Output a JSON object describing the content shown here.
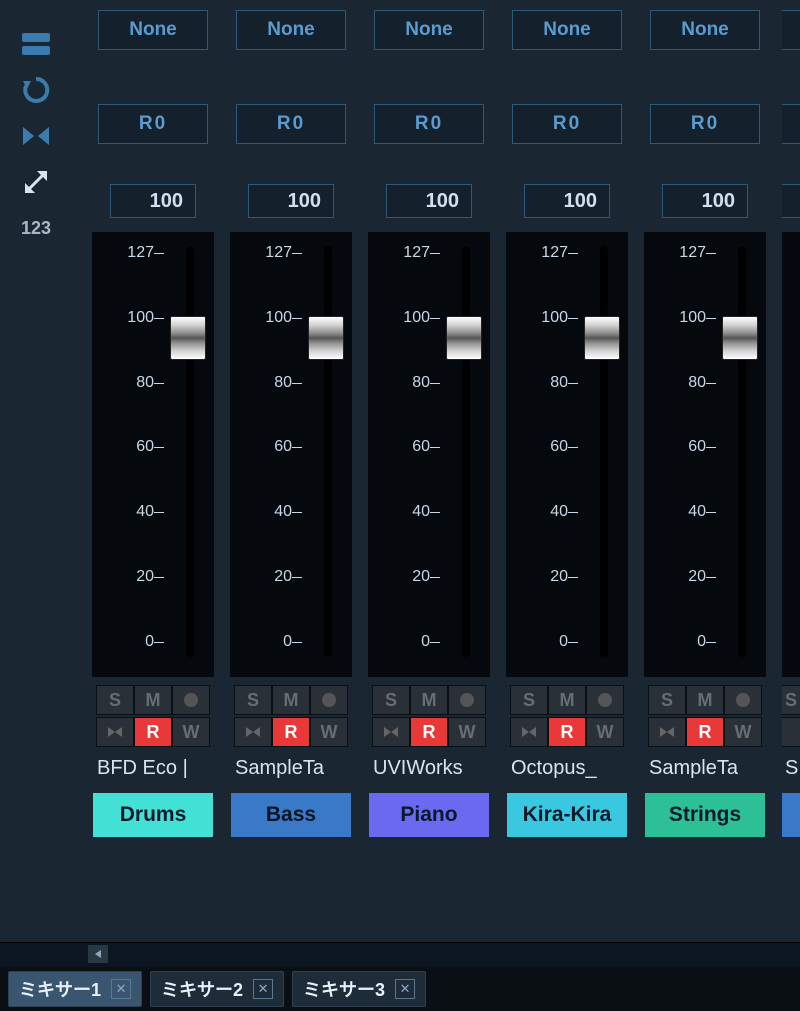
{
  "sidebar": {
    "label123": "123"
  },
  "scale_labels": [
    "127",
    "100",
    "80",
    "60",
    "40",
    "20",
    "0"
  ],
  "strips": [
    {
      "effect": "None",
      "pan": "R0",
      "volume": "100",
      "plugin": "BFD Eco |",
      "track_name": "Drums",
      "color": "#43e0d6"
    },
    {
      "effect": "None",
      "pan": "R0",
      "volume": "100",
      "plugin": "SampleTa",
      "track_name": "Bass",
      "color": "#3a78c8"
    },
    {
      "effect": "None",
      "pan": "R0",
      "volume": "100",
      "plugin": "UVIWorks",
      "track_name": "Piano",
      "color": "#6a6af0"
    },
    {
      "effect": "None",
      "pan": "R0",
      "volume": "100",
      "plugin": "Octopus_",
      "track_name": "Kira-Kira",
      "color": "#3ac8e0"
    },
    {
      "effect": "None",
      "pan": "R0",
      "volume": "100",
      "plugin": "SampleTa",
      "track_name": "Strings",
      "color": "#2dbf96"
    },
    {
      "effect": "",
      "pan": "",
      "volume": "",
      "plugin": "S",
      "track_name": "",
      "color": "#3a78c8"
    }
  ],
  "buttons": {
    "solo": "S",
    "mute": "M",
    "record_enable": "R",
    "write": "W"
  },
  "tabs": [
    {
      "label": "ミキサー1",
      "active": true
    },
    {
      "label": "ミキサー2",
      "active": false
    },
    {
      "label": "ミキサー3",
      "active": false
    }
  ]
}
